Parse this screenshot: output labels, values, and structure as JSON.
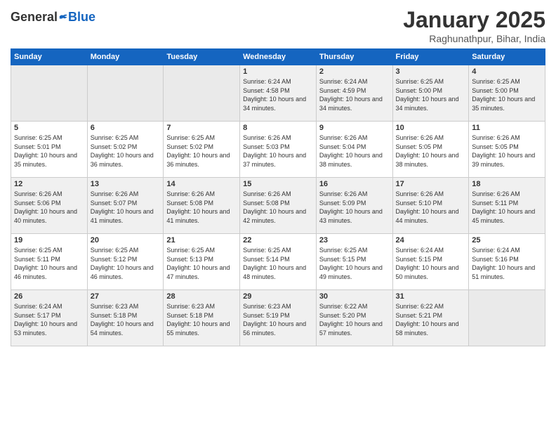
{
  "header": {
    "logo_general": "General",
    "logo_blue": "Blue",
    "month_title": "January 2025",
    "location": "Raghunathpur, Bihar, India"
  },
  "weekdays": [
    "Sunday",
    "Monday",
    "Tuesday",
    "Wednesday",
    "Thursday",
    "Friday",
    "Saturday"
  ],
  "weeks": [
    [
      {
        "day": "",
        "sunrise": "",
        "sunset": "",
        "daylight": ""
      },
      {
        "day": "",
        "sunrise": "",
        "sunset": "",
        "daylight": ""
      },
      {
        "day": "",
        "sunrise": "",
        "sunset": "",
        "daylight": ""
      },
      {
        "day": "1",
        "sunrise": "Sunrise: 6:24 AM",
        "sunset": "Sunset: 4:58 PM",
        "daylight": "Daylight: 10 hours and 34 minutes."
      },
      {
        "day": "2",
        "sunrise": "Sunrise: 6:24 AM",
        "sunset": "Sunset: 4:59 PM",
        "daylight": "Daylight: 10 hours and 34 minutes."
      },
      {
        "day": "3",
        "sunrise": "Sunrise: 6:25 AM",
        "sunset": "Sunset: 5:00 PM",
        "daylight": "Daylight: 10 hours and 34 minutes."
      },
      {
        "day": "4",
        "sunrise": "Sunrise: 6:25 AM",
        "sunset": "Sunset: 5:00 PM",
        "daylight": "Daylight: 10 hours and 35 minutes."
      }
    ],
    [
      {
        "day": "5",
        "sunrise": "Sunrise: 6:25 AM",
        "sunset": "Sunset: 5:01 PM",
        "daylight": "Daylight: 10 hours and 35 minutes."
      },
      {
        "day": "6",
        "sunrise": "Sunrise: 6:25 AM",
        "sunset": "Sunset: 5:02 PM",
        "daylight": "Daylight: 10 hours and 36 minutes."
      },
      {
        "day": "7",
        "sunrise": "Sunrise: 6:25 AM",
        "sunset": "Sunset: 5:02 PM",
        "daylight": "Daylight: 10 hours and 36 minutes."
      },
      {
        "day": "8",
        "sunrise": "Sunrise: 6:26 AM",
        "sunset": "Sunset: 5:03 PM",
        "daylight": "Daylight: 10 hours and 37 minutes."
      },
      {
        "day": "9",
        "sunrise": "Sunrise: 6:26 AM",
        "sunset": "Sunset: 5:04 PM",
        "daylight": "Daylight: 10 hours and 38 minutes."
      },
      {
        "day": "10",
        "sunrise": "Sunrise: 6:26 AM",
        "sunset": "Sunset: 5:05 PM",
        "daylight": "Daylight: 10 hours and 38 minutes."
      },
      {
        "day": "11",
        "sunrise": "Sunrise: 6:26 AM",
        "sunset": "Sunset: 5:05 PM",
        "daylight": "Daylight: 10 hours and 39 minutes."
      }
    ],
    [
      {
        "day": "12",
        "sunrise": "Sunrise: 6:26 AM",
        "sunset": "Sunset: 5:06 PM",
        "daylight": "Daylight: 10 hours and 40 minutes."
      },
      {
        "day": "13",
        "sunrise": "Sunrise: 6:26 AM",
        "sunset": "Sunset: 5:07 PM",
        "daylight": "Daylight: 10 hours and 41 minutes."
      },
      {
        "day": "14",
        "sunrise": "Sunrise: 6:26 AM",
        "sunset": "Sunset: 5:08 PM",
        "daylight": "Daylight: 10 hours and 41 minutes."
      },
      {
        "day": "15",
        "sunrise": "Sunrise: 6:26 AM",
        "sunset": "Sunset: 5:08 PM",
        "daylight": "Daylight: 10 hours and 42 minutes."
      },
      {
        "day": "16",
        "sunrise": "Sunrise: 6:26 AM",
        "sunset": "Sunset: 5:09 PM",
        "daylight": "Daylight: 10 hours and 43 minutes."
      },
      {
        "day": "17",
        "sunrise": "Sunrise: 6:26 AM",
        "sunset": "Sunset: 5:10 PM",
        "daylight": "Daylight: 10 hours and 44 minutes."
      },
      {
        "day": "18",
        "sunrise": "Sunrise: 6:26 AM",
        "sunset": "Sunset: 5:11 PM",
        "daylight": "Daylight: 10 hours and 45 minutes."
      }
    ],
    [
      {
        "day": "19",
        "sunrise": "Sunrise: 6:25 AM",
        "sunset": "Sunset: 5:11 PM",
        "daylight": "Daylight: 10 hours and 46 minutes."
      },
      {
        "day": "20",
        "sunrise": "Sunrise: 6:25 AM",
        "sunset": "Sunset: 5:12 PM",
        "daylight": "Daylight: 10 hours and 46 minutes."
      },
      {
        "day": "21",
        "sunrise": "Sunrise: 6:25 AM",
        "sunset": "Sunset: 5:13 PM",
        "daylight": "Daylight: 10 hours and 47 minutes."
      },
      {
        "day": "22",
        "sunrise": "Sunrise: 6:25 AM",
        "sunset": "Sunset: 5:14 PM",
        "daylight": "Daylight: 10 hours and 48 minutes."
      },
      {
        "day": "23",
        "sunrise": "Sunrise: 6:25 AM",
        "sunset": "Sunset: 5:15 PM",
        "daylight": "Daylight: 10 hours and 49 minutes."
      },
      {
        "day": "24",
        "sunrise": "Sunrise: 6:24 AM",
        "sunset": "Sunset: 5:15 PM",
        "daylight": "Daylight: 10 hours and 50 minutes."
      },
      {
        "day": "25",
        "sunrise": "Sunrise: 6:24 AM",
        "sunset": "Sunset: 5:16 PM",
        "daylight": "Daylight: 10 hours and 51 minutes."
      }
    ],
    [
      {
        "day": "26",
        "sunrise": "Sunrise: 6:24 AM",
        "sunset": "Sunset: 5:17 PM",
        "daylight": "Daylight: 10 hours and 53 minutes."
      },
      {
        "day": "27",
        "sunrise": "Sunrise: 6:23 AM",
        "sunset": "Sunset: 5:18 PM",
        "daylight": "Daylight: 10 hours and 54 minutes."
      },
      {
        "day": "28",
        "sunrise": "Sunrise: 6:23 AM",
        "sunset": "Sunset: 5:18 PM",
        "daylight": "Daylight: 10 hours and 55 minutes."
      },
      {
        "day": "29",
        "sunrise": "Sunrise: 6:23 AM",
        "sunset": "Sunset: 5:19 PM",
        "daylight": "Daylight: 10 hours and 56 minutes."
      },
      {
        "day": "30",
        "sunrise": "Sunrise: 6:22 AM",
        "sunset": "Sunset: 5:20 PM",
        "daylight": "Daylight: 10 hours and 57 minutes."
      },
      {
        "day": "31",
        "sunrise": "Sunrise: 6:22 AM",
        "sunset": "Sunset: 5:21 PM",
        "daylight": "Daylight: 10 hours and 58 minutes."
      },
      {
        "day": "",
        "sunrise": "",
        "sunset": "",
        "daylight": ""
      }
    ]
  ]
}
